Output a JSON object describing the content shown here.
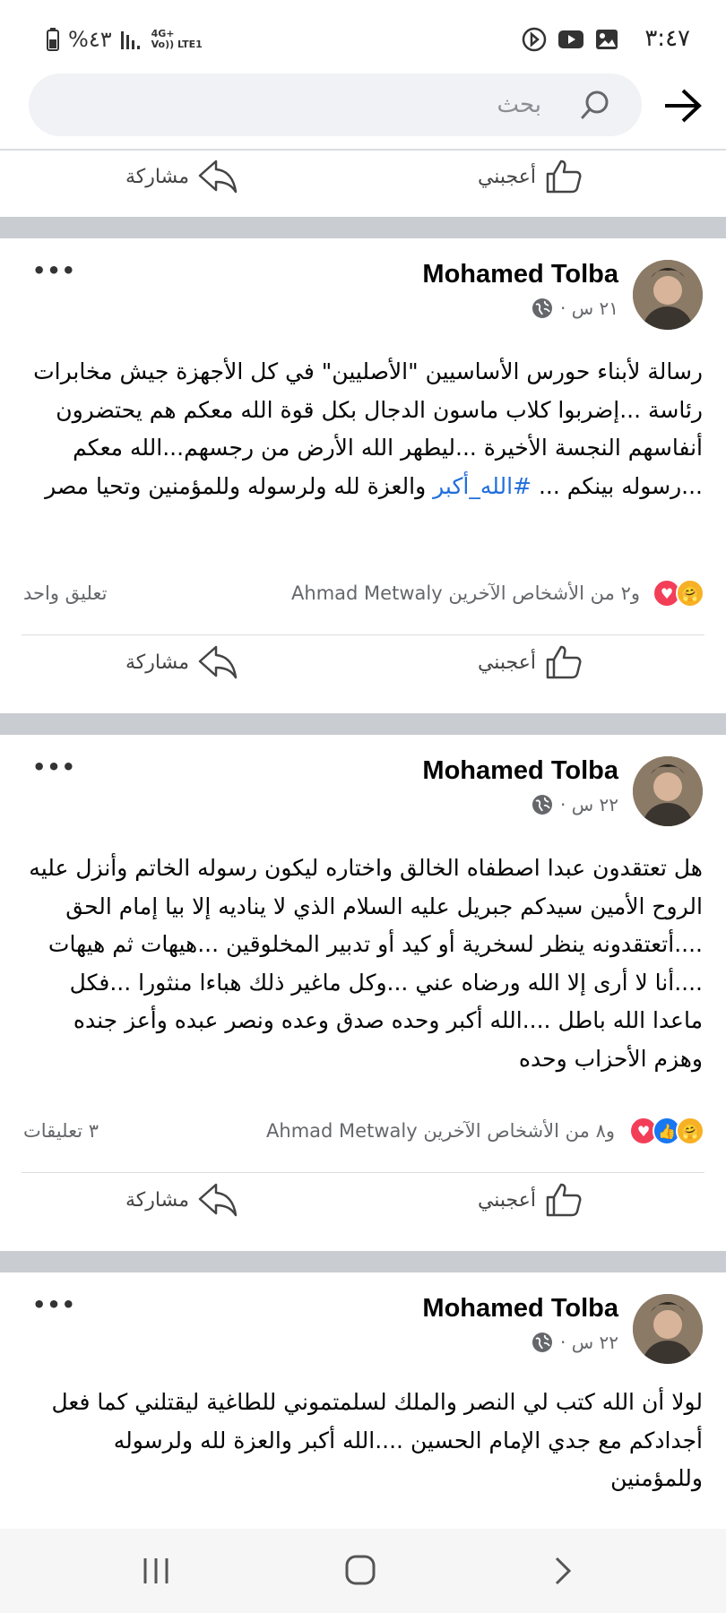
{
  "status": {
    "time": "٣:٤٧",
    "battery": "%٤٣",
    "network_top": "4G+",
    "network_bottom": "Vo)) LTE1"
  },
  "search": {
    "placeholder": "بحث"
  },
  "actions": {
    "like": "أعجبني",
    "share": "مشاركة"
  },
  "posts": [
    {
      "author": "Mohamed Tolba",
      "time": "٢١ س ·",
      "text_before": "رسالة لأبناء حورس الأساسيين \"الأصليين\" في كل الأجهزة جيش مخابرات رئاسة ...إضربوا كلاب ماسون الدجال بكل قوة الله معكم هم يحتضرون أنفاسهم النجسة الأخيرة ...ليطهر الله الأرض من رجسهم...الله معكم ...رسوله بينكم ... ",
      "hashtag": "#الله_أكبر",
      "text_after": " والعزة لله ولرسوله وللمؤمنين وتحيا مصر",
      "reactions_name": "Ahmad Metwaly",
      "reactions_rest": "و٢ من الأشخاص الآخرين",
      "comments": "تعليق واحد"
    },
    {
      "author": "Mohamed Tolba",
      "time": "٢٢ س ·",
      "text": "هل تعتقدون عبدا اصطفاه الخالق واختاره ليكون رسوله الخاتم وأنزل عليه الروح الأمين سيدكم جبريل عليه السلام الذي لا يناديه إلا بيا إمام الحق ....أتعتقدونه ينظر لسخرية أو كيد أو تدبير المخلوقين ...هيهات ثم هيهات ....أنا لا أرى إلا الله ورضاه عني ...وكل ماغير ذلك هباءا منثورا ...فكل ماعدا الله باطل ....الله أكبر وحده صدق وعده ونصر عبده وأعز جنده وهزم الأحزاب وحده",
      "reactions_name": "Ahmad Metwaly",
      "reactions_rest": "و٨ من الأشخاص الآخرين",
      "comments": "٣ تعليقات"
    },
    {
      "author": "Mohamed Tolba",
      "time": "٢٢ س ·",
      "text": "لولا أن الله كتب لي النصر والملك لسلمتموني للطاغية ليقتلني كما فعل أجدادكم مع جدي الإمام الحسين ....الله أكبر والعزة لله ولرسوله وللمؤمنين"
    }
  ],
  "colors": {
    "hashtag": "#216fdb",
    "separator": "#c9ccd1",
    "secondary_text": "#65676b",
    "love": "#f33e58",
    "like": "#1877f2",
    "care": "#f7b125"
  },
  "icons": [
    "battery-icon",
    "signal-icon",
    "youtube-icon",
    "gallery-icon",
    "hotspot-icon",
    "search-icon",
    "back-arrow-icon",
    "like-icon",
    "share-icon",
    "globe-icon",
    "more-icon",
    "care-reaction-icon",
    "love-reaction-icon",
    "like-reaction-icon",
    "recents-icon",
    "home-icon",
    "back-nav-icon"
  ]
}
